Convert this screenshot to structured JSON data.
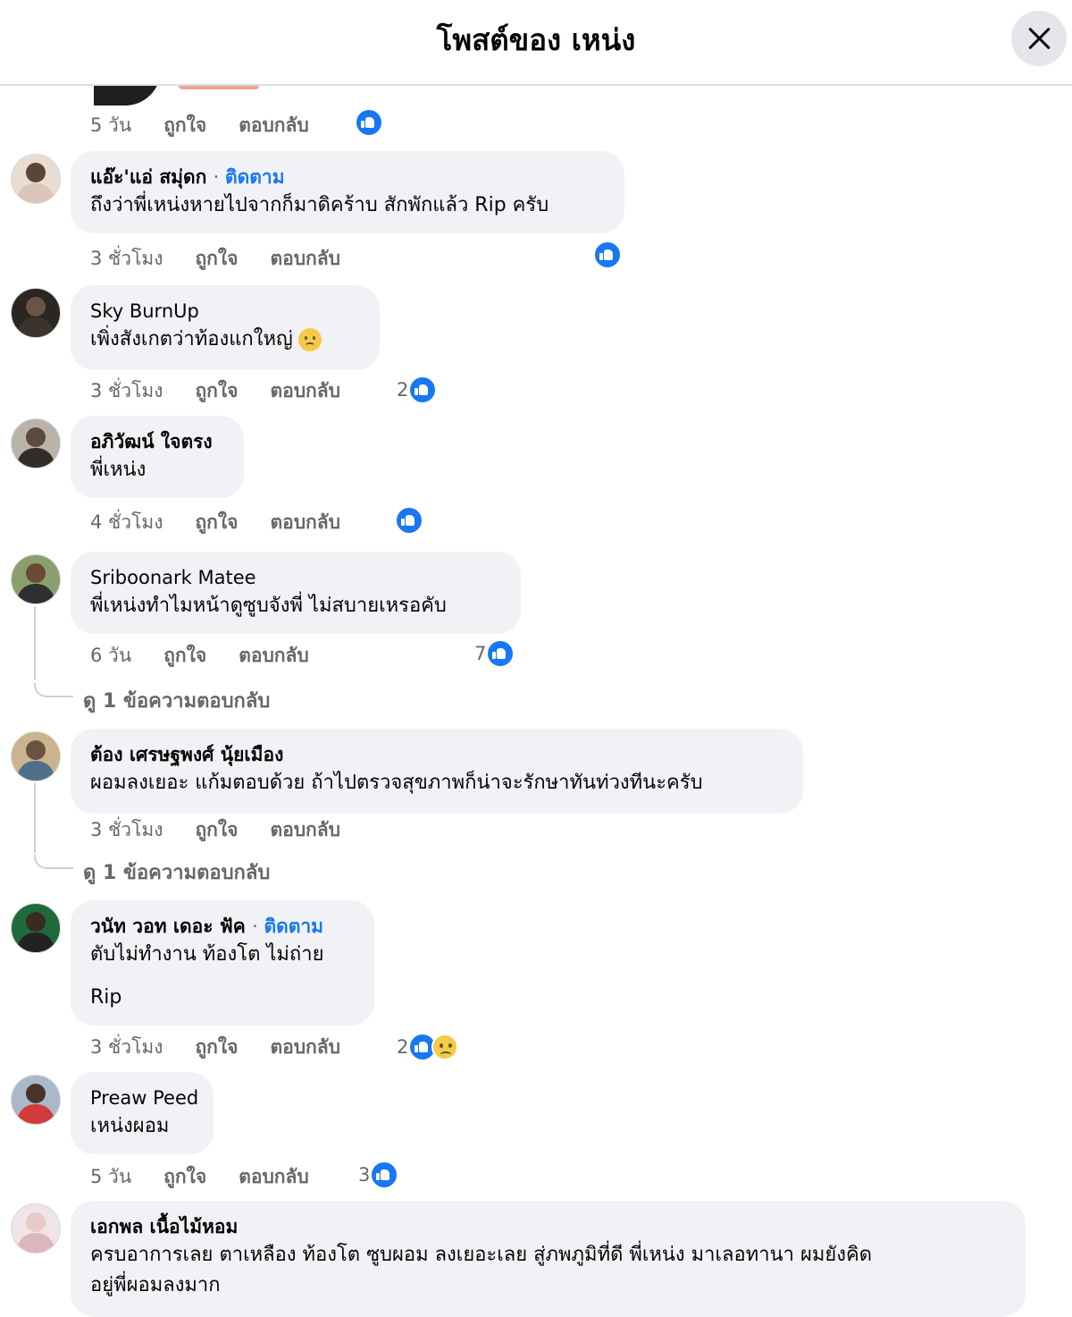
{
  "header": {
    "title": "โพสต์ของ เหน่ง"
  },
  "top_actions": {
    "time": "5 วัน",
    "like": "ถูกใจ",
    "reply": "ตอบกลับ"
  },
  "comments": [
    {
      "name": "แอ๊ะ'แอ่ สมุ่ดก",
      "follow": "ติดตาม",
      "text": "ถึงว่าพี่เหน่งหายไปจากก็มาดิคร้าบ สักพักแล้ว Rip ครับ",
      "time": "3 ชั่วโมง",
      "like": "ถูกใจ",
      "reply": "ตอบกลับ",
      "reaction_count": ""
    },
    {
      "name": "Sky BurnUp",
      "text": "เพิ่งสังเกตว่าท้องแกใหญ่",
      "time": "3 ชั่วโมง",
      "like": "ถูกใจ",
      "reply": "ตอบกลับ",
      "reaction_count": "2"
    },
    {
      "name": "อภิวัฒน์ ใจตรง",
      "text": "พี่เหน่ง",
      "time": "4 ชั่วโมง",
      "like": "ถูกใจ",
      "reply": "ตอบกลับ",
      "reaction_count": ""
    },
    {
      "name": "Sriboonark Matee",
      "text": "พี่เหน่งทำไมหน้าดูซูบจังพี่ ไม่สบายเหรอคับ",
      "time": "6 วัน",
      "like": "ถูกใจ",
      "reply": "ตอบกลับ",
      "reaction_count": "7",
      "view_replies": "ดู 1 ข้อความตอบกลับ"
    },
    {
      "name": "ต้อง เศรษฐพงศ์ นุ้ยเมือง",
      "text": "ผอมลงเยอะ แก้มตอบด้วย ถ้าไปตรวจสุขภาพก็น่าจะรักษาทันท่วงทีนะครับ",
      "time": "3 ชั่วโมง",
      "like": "ถูกใจ",
      "reply": "ตอบกลับ",
      "reaction_count": "",
      "view_replies": "ดู 1 ข้อความตอบกลับ"
    },
    {
      "name": "วนัท วอท เดอะ ฟัค",
      "follow": "ติดตาม",
      "text": "ตับไม่ทำงาน ท้องโต ไม่ถ่าย",
      "text2": "Rip",
      "time": "3 ชั่วโมง",
      "like": "ถูกใจ",
      "reply": "ตอบกลับ",
      "reaction_count": "2"
    },
    {
      "name": "Preaw Peed",
      "text": "เหน่งผอม",
      "time": "5 วัน",
      "like": "ถูกใจ",
      "reply": "ตอบกลับ",
      "reaction_count": "3"
    },
    {
      "name": "เอกพล เนื้อไม้หอม",
      "text": "ครบอาการเลย ตาเหลือง ท้องโต ซูบผอม ลงเยอะเลย สู่ภพภูมิที่ดี พี่เหน่ง มาเลอทานา ผมยังคิด",
      "text_cont": "อยู่พี่ผอมลงมาก"
    }
  ],
  "icons": {
    "like": "like-icon",
    "sad": "sad-reaction-icon",
    "close": "close-icon"
  },
  "colors": {
    "link_blue": "#1877f2",
    "bubble_bg": "#f0f2f5",
    "meta_gray": "#65676b"
  }
}
